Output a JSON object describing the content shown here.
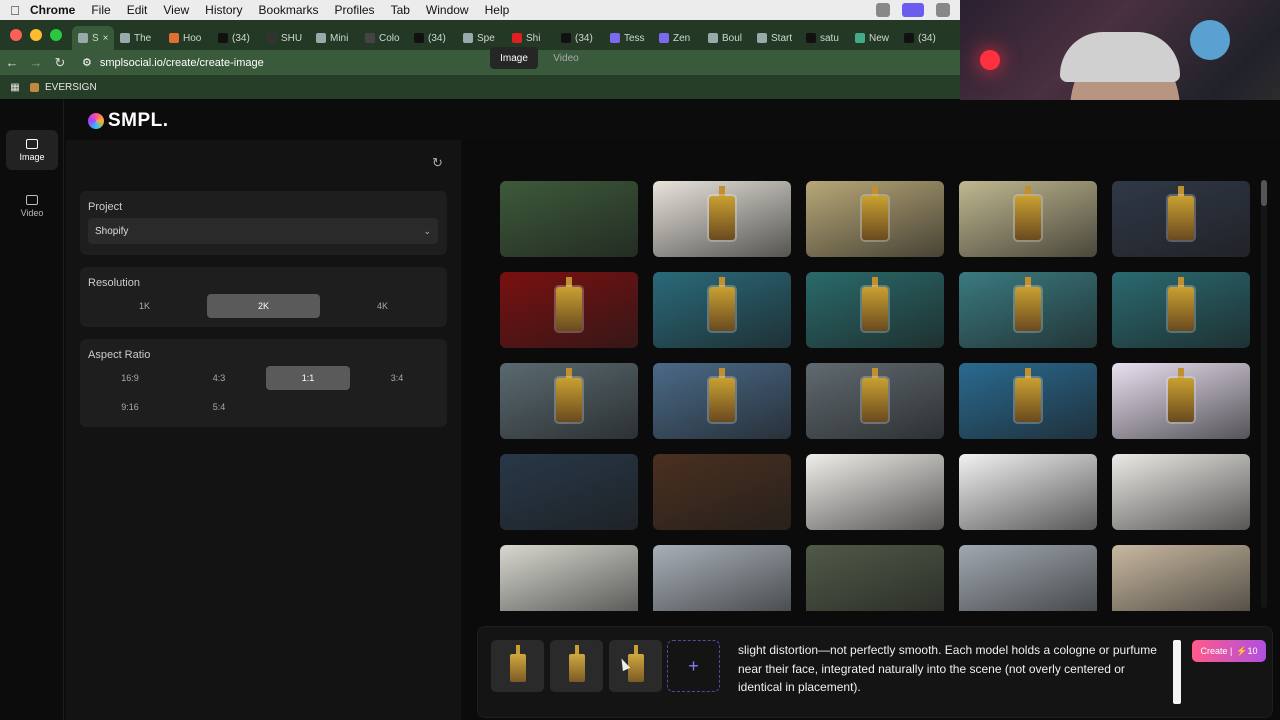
{
  "menubar": {
    "app": "Chrome",
    "items": [
      "File",
      "Edit",
      "View",
      "History",
      "Bookmarks",
      "Profiles",
      "Tab",
      "Window",
      "Help"
    ]
  },
  "browser": {
    "tabs": [
      {
        "label": "S",
        "icon": "smpl-favicon",
        "active": true
      },
      {
        "label": "The",
        "icon": "globe-favicon"
      },
      {
        "label": "Hoo",
        "icon": "orange-favicon"
      },
      {
        "label": "(34)",
        "icon": "tiktok-favicon"
      },
      {
        "label": "SHU",
        "icon": "shopify-favicon"
      },
      {
        "label": "Mini",
        "icon": "globe-favicon"
      },
      {
        "label": "Colo",
        "icon": "chatgpt-favicon"
      },
      {
        "label": "(34)",
        "icon": "tiktok-favicon"
      },
      {
        "label": "Spe",
        "icon": "globe-favicon"
      },
      {
        "label": "Shi",
        "icon": "youtube-favicon"
      },
      {
        "label": "(34)",
        "icon": "tiktok-favicon"
      },
      {
        "label": "Tess",
        "icon": "zendesk-favicon"
      },
      {
        "label": "Zen",
        "icon": "zendesk-favicon"
      },
      {
        "label": "Boul",
        "icon": "globe-favicon"
      },
      {
        "label": "Start",
        "icon": "app-favicon"
      },
      {
        "label": "satu",
        "icon": "tiktok-favicon"
      },
      {
        "label": "New",
        "icon": "chrome-favicon"
      },
      {
        "label": "(34)",
        "icon": "tiktok-favicon"
      }
    ],
    "url": "smplsocial.io/create/create-image",
    "bookmark": "EVERSIGN"
  },
  "app": {
    "logo": "SMPL.",
    "rail": [
      {
        "label": "Image",
        "icon": "image-icon",
        "active": true
      },
      {
        "label": "Video",
        "icon": "video-icon",
        "active": false
      }
    ],
    "project": {
      "label": "Project",
      "value": "Shopify"
    },
    "resolution": {
      "label": "Resolution",
      "options": [
        "1K",
        "2K",
        "4K"
      ],
      "selected": "2K"
    },
    "aspect": {
      "label": "Aspect Ratio",
      "options": [
        "16:9",
        "4:3",
        "1:1",
        "3:4",
        "9:16",
        "5:4"
      ],
      "selected": "1:1"
    },
    "media_tabs": [
      {
        "label": "Image",
        "active": true
      },
      {
        "label": "Video",
        "active": false
      }
    ],
    "gallery": [
      {
        "kind": "models",
        "bg": "#3d5a3a"
      },
      {
        "kind": "bottles",
        "bg": "#e8e4dc"
      },
      {
        "kind": "field",
        "bg": "#b8a878"
      },
      {
        "kind": "field",
        "bg": "#c0b890"
      },
      {
        "kind": "plush",
        "bg": "#303848"
      },
      {
        "kind": "bottle",
        "bg": "#7a1010"
      },
      {
        "kind": "roses",
        "bg": "#2a6a7a"
      },
      {
        "kind": "roses",
        "bg": "#2a6a6a"
      },
      {
        "kind": "roses",
        "bg": "#3a7a80"
      },
      {
        "kind": "roses",
        "bg": "#2a6a70"
      },
      {
        "kind": "waves",
        "bg": "#5a6a70"
      },
      {
        "kind": "ice",
        "bg": "#4a6a88"
      },
      {
        "kind": "waves",
        "bg": "#606a70"
      },
      {
        "kind": "ocean",
        "bg": "#2a6a90"
      },
      {
        "kind": "splash",
        "bg": "#e8e0f0"
      },
      {
        "kind": "gym",
        "bg": "#283848"
      },
      {
        "kind": "fruit",
        "bg": "#4a3020"
      },
      {
        "kind": "blender",
        "bg": "#f0eeea"
      },
      {
        "kind": "blender",
        "bg": "#f2f2f2"
      },
      {
        "kind": "blender",
        "bg": "#eceae6"
      },
      {
        "kind": "brush",
        "bg": "#d8d8d0"
      },
      {
        "kind": "creator",
        "bg": "#a8b0b8"
      },
      {
        "kind": "creator",
        "bg": "#505a48"
      },
      {
        "kind": "creator",
        "bg": "#a0a8b0"
      },
      {
        "kind": "room",
        "bg": "#c8b8a0"
      }
    ],
    "composer": {
      "ref_count": 3,
      "prompt": "slight distortion—not perfectly smooth. Each model holds a cologne or purfume near their face, integrated naturally into the scene (not overly centered or identical in placement).",
      "create_label": "Create |",
      "credits": "⚡10"
    }
  }
}
